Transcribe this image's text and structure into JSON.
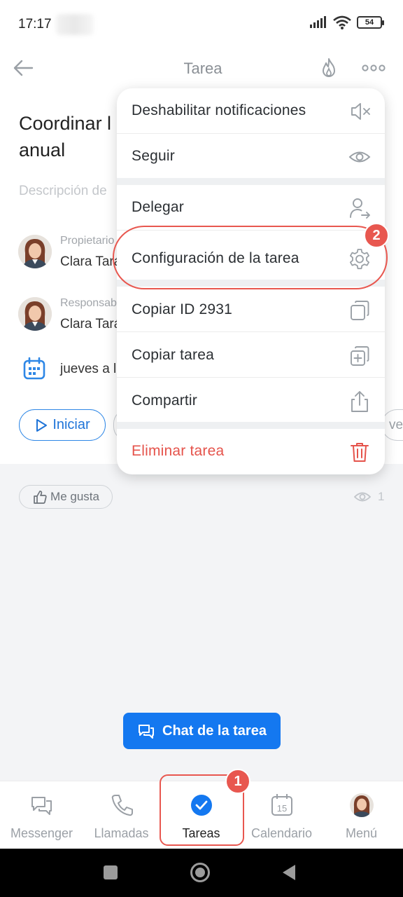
{
  "status": {
    "time": "17:17",
    "battery": "54"
  },
  "header": {
    "title": "Tarea"
  },
  "task": {
    "title_line1": "Coordinar l",
    "title_line2": "anual",
    "description_placeholder": "Descripción de",
    "owner_role": "Propietario",
    "owner_name": "Clara Tarás",
    "responsible_role": "Responsable",
    "responsible_name": "Clara Tarás",
    "deadline": "jueves a las"
  },
  "actions": {
    "start": "Iniciar",
    "more_label": "ve"
  },
  "feed": {
    "like": "Me gusta",
    "views": "1"
  },
  "chat_button": "Chat de la tarea",
  "menu": {
    "items": [
      {
        "label": "Deshabilitar notificaciones",
        "icon": "mute-icon"
      },
      {
        "label": "Seguir",
        "icon": "eye-icon"
      },
      {
        "label": "Delegar",
        "icon": "delegate-user-icon"
      },
      {
        "label": "Configuración de la tarea",
        "icon": "gear-icon"
      },
      {
        "label": "Copiar ID 2931",
        "icon": "copy-icon"
      },
      {
        "label": "Copiar tarea",
        "icon": "copy-add-icon"
      },
      {
        "label": "Compartir",
        "icon": "share-icon"
      },
      {
        "label": "Eliminar tarea",
        "icon": "trash-icon"
      }
    ]
  },
  "bottom_nav": [
    {
      "label": "Messenger",
      "icon": "chat-bubbles-icon"
    },
    {
      "label": "Llamadas",
      "icon": "phone-icon"
    },
    {
      "label": "Tareas",
      "icon": "check-circle-icon",
      "active": true
    },
    {
      "label": "Calendario",
      "icon": "calendar-icon",
      "day": "15"
    },
    {
      "label": "Menú",
      "icon": "avatar-icon"
    }
  ],
  "annotations": {
    "badge_1": "1",
    "badge_2": "2"
  },
  "colors": {
    "accent": "#1478f0",
    "danger": "#e5534b",
    "highlight": "#e8574f"
  }
}
